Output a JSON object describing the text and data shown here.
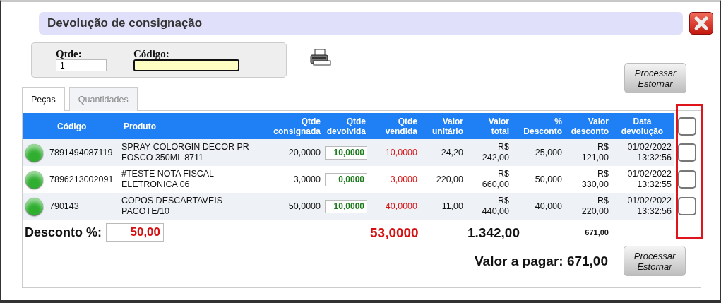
{
  "dialog": {
    "title": "Devolução de consignação"
  },
  "filter": {
    "qtde_label": "Qtde:",
    "qtde_value": "1",
    "codigo_label": "Código:"
  },
  "top_button": "Processar Estornar",
  "tabs": [
    {
      "label": "Peças",
      "selected": true
    },
    {
      "label": "Quantidades",
      "selected": false
    }
  ],
  "table": {
    "columns": [
      {
        "lines": [
          "Código"
        ]
      },
      {
        "lines": [
          "Produto"
        ]
      },
      {
        "lines": [
          "Qtde",
          "consignada"
        ]
      },
      {
        "lines": [
          "Qtde",
          "devolvida"
        ]
      },
      {
        "lines": [
          "Qtde",
          "vendida"
        ]
      },
      {
        "lines": [
          "Valor",
          "unitário"
        ]
      },
      {
        "lines": [
          "Valor",
          "total"
        ]
      },
      {
        "lines": [
          "%",
          "Desconto"
        ]
      },
      {
        "lines": [
          "Valor",
          "desconto"
        ]
      },
      {
        "lines": [
          "Data",
          "devolução"
        ]
      }
    ],
    "select_all_checked": false,
    "rows": [
      {
        "color": "#2fae2f",
        "code": "7891494087119",
        "product": "SPRAY COLORGIN DECOR PR FOSCO 350ML 8711",
        "qty_consigned": "20,0000",
        "qty_returned": "10,0000",
        "qty_sold": "10,0000",
        "unit_value": "24,20",
        "total_value": "R$ 242,00",
        "discount_pct": "25,000",
        "discount_value": "R$ 121,00",
        "return_date": "01/02/2022 13:32:56",
        "checked": false
      },
      {
        "color": "#2fae2f",
        "code": "7896213002091",
        "product": "#TESTE NOTA FISCAL ELETRONICA 06",
        "qty_consigned": "3,0000",
        "qty_returned": "0,0000",
        "qty_sold": "3,0000",
        "unit_value": "220,00",
        "total_value": "R$ 660,00",
        "discount_pct": "50,000",
        "discount_value": "R$ 330,00",
        "return_date": "01/02/2022 13:32:55",
        "checked": false
      },
      {
        "color": "#2fae2f",
        "code": "790143",
        "product": "COPOS DESCARTAVEIS PACOTE/10",
        "qty_consigned": "50,0000",
        "qty_returned": "10,0000",
        "qty_sold": "40,0000",
        "unit_value": "11,00",
        "total_value": "R$ 440,00",
        "discount_pct": "40,000",
        "discount_value": "R$ 220,00",
        "return_date": "01/02/2022 13:32:56",
        "checked": false
      }
    ]
  },
  "totals": {
    "discount_label": "Desconto %:",
    "discount_value": "50,00",
    "qty_sold_total": "53,0000",
    "total_value": "1.342,00",
    "discount_total": "671,00"
  },
  "amount_due": "Valor a pagar: 671,00",
  "bottom_button": "Processar Estornar"
}
